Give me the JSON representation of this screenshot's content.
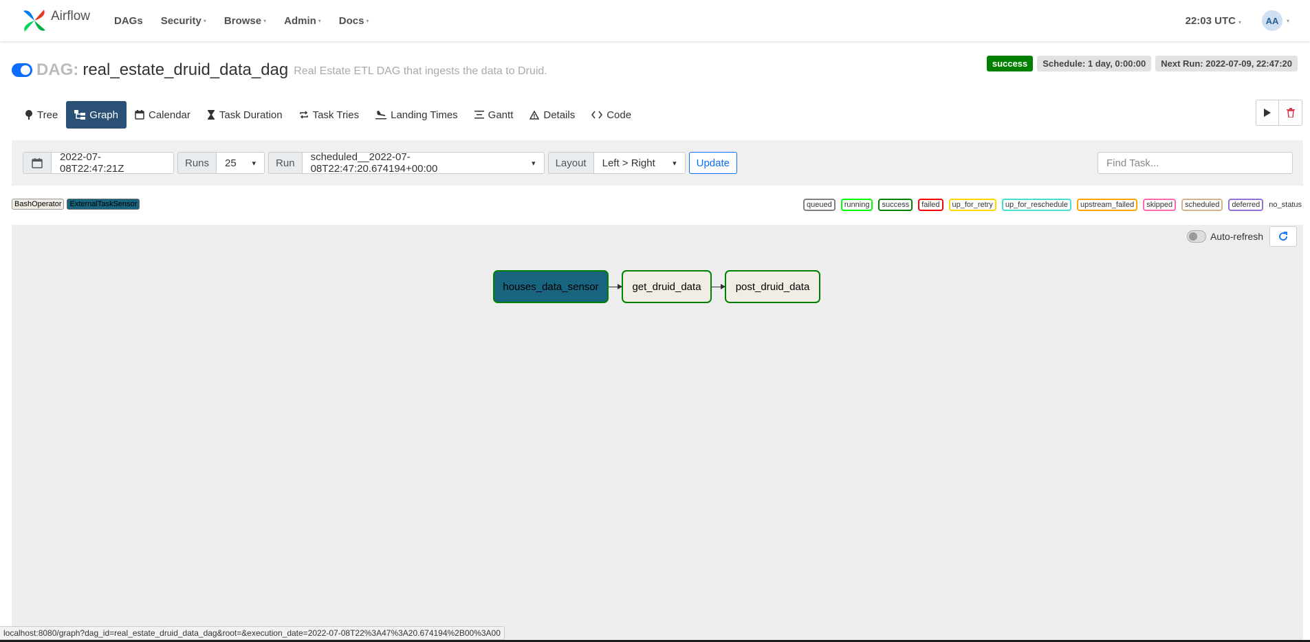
{
  "navbar": {
    "brand": "Airflow",
    "items": [
      {
        "label": "DAGs",
        "caret": false
      },
      {
        "label": "Security",
        "caret": true
      },
      {
        "label": "Browse",
        "caret": true
      },
      {
        "label": "Admin",
        "caret": true
      },
      {
        "label": "Docs",
        "caret": true
      }
    ],
    "clock": "22:03 UTC",
    "avatar": "AA"
  },
  "header": {
    "dag_label": "DAG:",
    "dag_id": "real_estate_druid_data_dag",
    "description": "Real Estate ETL DAG that ingests the data to Druid.",
    "status": "success",
    "schedule": "Schedule: 1 day, 0:00:00",
    "next_run": "Next Run: 2022-07-09, 22:47:20"
  },
  "tabs": [
    {
      "label": "Tree",
      "icon": "tree-icon"
    },
    {
      "label": "Graph",
      "icon": "graph-icon"
    },
    {
      "label": "Calendar",
      "icon": "calendar-icon"
    },
    {
      "label": "Task Duration",
      "icon": "hourglass-icon"
    },
    {
      "label": "Task Tries",
      "icon": "repeat-icon"
    },
    {
      "label": "Landing Times",
      "icon": "plane-landing-icon"
    },
    {
      "label": "Gantt",
      "icon": "gantt-icon"
    },
    {
      "label": "Details",
      "icon": "warning-icon"
    },
    {
      "label": "Code",
      "icon": "code-icon"
    }
  ],
  "filters": {
    "base_date": "2022-07-08T22:47:21Z",
    "runs_label": "Runs",
    "runs_value": "25",
    "run_label": "Run",
    "run_value": "scheduled__2022-07-08T22:47:20.674194+00:00",
    "layout_label": "Layout",
    "layout_value": "Left > Right",
    "update": "Update",
    "find_task_placeholder": "Find Task..."
  },
  "operators": [
    "BashOperator",
    "ExternalTaskSensor"
  ],
  "states": [
    {
      "label": "queued",
      "color": "#808080"
    },
    {
      "label": "running",
      "color": "#00ff00"
    },
    {
      "label": "success",
      "color": "#008000"
    },
    {
      "label": "failed",
      "color": "#ff0000"
    },
    {
      "label": "up_for_retry",
      "color": "#ffd700"
    },
    {
      "label": "up_for_reschedule",
      "color": "#40e0d0"
    },
    {
      "label": "upstream_failed",
      "color": "#ffa500"
    },
    {
      "label": "skipped",
      "color": "#ff69b4"
    },
    {
      "label": "scheduled",
      "color": "#d2b48c"
    },
    {
      "label": "deferred",
      "color": "#9370db"
    },
    {
      "label": "no_status",
      "color": ""
    }
  ],
  "graph": {
    "auto_refresh": "Auto-refresh",
    "nodes": [
      "houses_data_sensor",
      "get_druid_data",
      "post_druid_data"
    ]
  },
  "status_link": "localhost:8080/graph?dag_id=real_estate_druid_data_dag&root=&execution_date=2022-07-08T22%3A47%3A20.674194%2B00%3A00",
  "colors": {
    "active_tab": "#2a5175",
    "success": "#008000",
    "sensor_node": "#19647e",
    "bash_node": "#f0ede4"
  }
}
